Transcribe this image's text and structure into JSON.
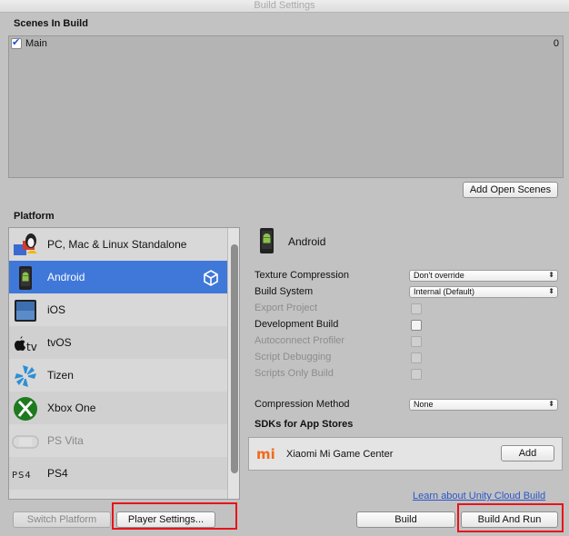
{
  "window": {
    "title": "Build Settings"
  },
  "scenes": {
    "header": "Scenes In Build",
    "items": [
      {
        "name": "Main",
        "index": "0",
        "checked": true
      }
    ],
    "add_open_scenes": "Add Open Scenes"
  },
  "platform": {
    "header": "Platform",
    "items": [
      {
        "label": "PC, Mac & Linux Standalone",
        "icon": "pc-mac-linux-icon"
      },
      {
        "label": "Android",
        "icon": "android-icon",
        "selected": true,
        "active_icon": "unity-logo-icon"
      },
      {
        "label": "iOS",
        "icon": "ios-icon"
      },
      {
        "label": "tvOS",
        "icon": "tvos-icon"
      },
      {
        "label": "Tizen",
        "icon": "tizen-icon"
      },
      {
        "label": "Xbox One",
        "icon": "xbox-icon"
      },
      {
        "label": "PS Vita",
        "icon": "ps-vita-icon"
      },
      {
        "label": "PS4",
        "icon": "ps4-icon"
      },
      {
        "label": "",
        "icon": "html5-icon"
      }
    ]
  },
  "settings": {
    "platform_title": "Android",
    "texture_compression": {
      "label": "Texture Compression",
      "value": "Don't override"
    },
    "build_system": {
      "label": "Build System",
      "value": "Internal (Default)"
    },
    "export_project": {
      "label": "Export Project",
      "enabled": false
    },
    "development_build": {
      "label": "Development Build",
      "enabled": true
    },
    "autoconnect_profiler": {
      "label": "Autoconnect Profiler",
      "enabled": false
    },
    "script_debugging": {
      "label": "Script Debugging",
      "enabled": false
    },
    "scripts_only_build": {
      "label": "Scripts Only Build",
      "enabled": false
    },
    "compression_method": {
      "label": "Compression Method",
      "value": "None"
    },
    "sdk_header": "SDKs for App Stores",
    "sdk_item": {
      "name": "Xiaomi Mi Game Center",
      "logo": "mi",
      "button": "Add"
    }
  },
  "footer": {
    "cloud_link": "Learn about Unity Cloud Build",
    "switch_platform": "Switch Platform",
    "player_settings": "Player Settings...",
    "build": "Build",
    "build_and_run": "Build And Run"
  },
  "colors": {
    "selection": "#3f78d9",
    "highlight_box": "#e8141a",
    "link": "#2c56c9"
  }
}
